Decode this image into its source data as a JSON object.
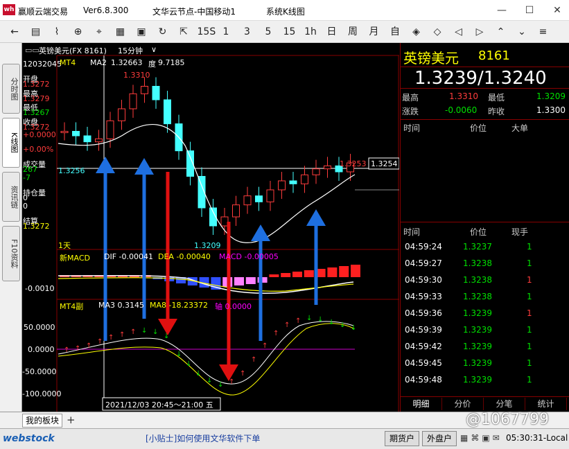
{
  "window": {
    "app": "赢顺云端交易",
    "version": "Ver6.8.300",
    "server": "文华云节点-中国移动1",
    "view": "系统K线图"
  },
  "toolbar": {
    "items": [
      "←",
      "▤",
      "⌇",
      "⊕",
      "⌖",
      "▦",
      "▣",
      "↻",
      "⇱",
      "15S",
      "1",
      "3",
      "5",
      "15",
      "1h",
      "日",
      "周",
      "月",
      "自",
      "◈",
      "◇",
      "◁",
      "▷",
      "⌃",
      "⌄",
      "≡"
    ]
  },
  "lefttabs": [
    "分时图",
    "K线图",
    "资讯链",
    "F10资料"
  ],
  "chart": {
    "header": "英镑美元(FX 8161)",
    "period": "15分钟",
    "mt4": {
      "name": "MT4",
      "ma2_label": "MA2",
      "ma2": "1.32663",
      "deg_label": "度",
      "deg": "9.7185"
    },
    "high_label": "1.3310",
    "low_label": "1.3209",
    "left_price": "1.3256",
    "price_tag": "1.3253",
    "cur_tag": "1.3254",
    "day_label": "1天",
    "macd": {
      "name": "新MACD",
      "dif": "DIF -0.00041",
      "dea": "DEA -0.00040",
      "macd": "MACD -0.00005",
      "axis": "-0.0010"
    },
    "mt4sub": {
      "name": "MT4副",
      "ma3": "MA3 0.3145",
      "ma8": "MA8 -18.23372",
      "axis": "轴 0.0000",
      "ticks": [
        "50.0000",
        "0.0000",
        "-50.0000",
        "-100.0000"
      ]
    },
    "timestamp": "2021/12/03 20:45～21:00 五",
    "info": [
      {
        "k": "",
        "v": "12032045",
        "c": "white"
      },
      {
        "k": "开盘",
        "v": "1.3272",
        "c": "red"
      },
      {
        "k": "最高",
        "v": "1.3279",
        "c": "red"
      },
      {
        "k": "最低",
        "v": "1.3267",
        "c": "green"
      },
      {
        "k": "收盘",
        "v": "1.3272",
        "c": "red"
      },
      {
        "k": "",
        "v": "+0.0000",
        "c": "red"
      },
      {
        "k": "",
        "v": "+0.00%",
        "c": "red"
      },
      {
        "k": "成交量",
        "v": "267",
        "c": "green"
      },
      {
        "k": "",
        "v": "-7",
        "c": "green"
      },
      {
        "k": "持仓量",
        "v": "0",
        "c": "white"
      },
      {
        "k": "",
        "v": "0",
        "c": "white"
      },
      {
        "k": "结算",
        "v": "1.3272",
        "c": "yellow"
      }
    ]
  },
  "chart_data": {
    "type": "line",
    "series": [
      {
        "values": [
          1.3275,
          1.3272,
          1.3268,
          1.327,
          1.3282,
          1.329,
          1.33,
          1.3305,
          1.3296,
          1.328,
          1.3262,
          1.3245,
          1.3224,
          1.3212,
          1.3218,
          1.3226,
          1.3232,
          1.3228,
          1.3236,
          1.3242,
          1.324,
          1.3246,
          1.325,
          1.3252,
          1.3248,
          1.3254
        ]
      }
    ]
  },
  "quote": {
    "name": "英镑美元",
    "code": "8161",
    "price": "1.3239/1.3240",
    "high_label": "最高",
    "high": "1.3310",
    "low_label": "最低",
    "low": "1.3209",
    "chg_label": "涨跌",
    "chg": "-0.0060",
    "prev_label": "昨收",
    "prev": "1.3300"
  },
  "bigorders": {
    "cols": [
      "时间",
      "价位",
      "大单"
    ]
  },
  "ticks": {
    "cols": [
      "时间",
      "价位",
      "现手"
    ],
    "rows": [
      {
        "t": "04:59:24",
        "p": "1.3237",
        "q": "1",
        "qc": "green"
      },
      {
        "t": "04:59:27",
        "p": "1.3238",
        "q": "1",
        "qc": "green"
      },
      {
        "t": "04:59:30",
        "p": "1.3238",
        "q": "1",
        "qc": "red"
      },
      {
        "t": "04:59:33",
        "p": "1.3238",
        "q": "1",
        "qc": "green"
      },
      {
        "t": "04:59:36",
        "p": "1.3239",
        "q": "1",
        "qc": "red"
      },
      {
        "t": "04:59:39",
        "p": "1.3239",
        "q": "1",
        "qc": "green"
      },
      {
        "t": "04:59:42",
        "p": "1.3239",
        "q": "1",
        "qc": "green"
      },
      {
        "t": "04:59:45",
        "p": "1.3239",
        "q": "1",
        "qc": "green"
      },
      {
        "t": "04:59:48",
        "p": "1.3239",
        "q": "1",
        "qc": "green"
      }
    ]
  },
  "righttabs": [
    "明细",
    "分价",
    "分笔",
    "统计"
  ],
  "bottom": {
    "tab": "我的板块",
    "add": "+",
    "watermark": "@1067799"
  },
  "status": {
    "brand": "webstock",
    "tip": "[小贴士]如何使用文华软件下单",
    "futures": "期货户",
    "fx": "外盘户",
    "clock": "05:30:31-Local"
  },
  "colors": {
    "up": "#ff3c3c",
    "down": "#00e000",
    "arrow_blue": "#1e6fe0",
    "arrow_red": "#e01010"
  }
}
